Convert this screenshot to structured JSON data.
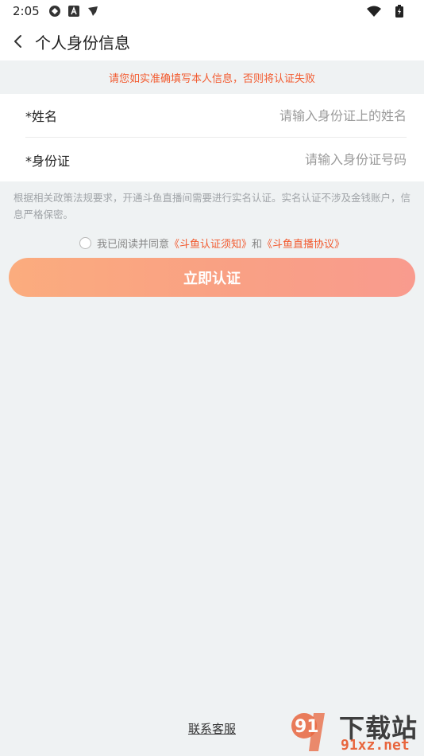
{
  "status_bar": {
    "time": "2:05"
  },
  "header": {
    "title": "个人身份信息"
  },
  "warning": "请您如实准确填写本人信息，否则将认证失败",
  "form": {
    "name_label": "*姓名",
    "name_placeholder": "请输入身份证上的姓名",
    "id_label": "*身份证",
    "id_placeholder": "请输入身份证号码"
  },
  "notice": "根据相关政策法规要求，开通斗鱼直播间需要进行实名认证。实名认证不涉及金钱账户，信息严格保密。",
  "agreement": {
    "prefix": "我已阅读并同意",
    "link1": "《斗鱼认证须知》",
    "middle": "和",
    "link2": "《斗鱼直播协议》"
  },
  "submit_label": "立即认证",
  "contact_label": "联系客服",
  "watermark": {
    "brand": "下载站",
    "url": "91xz.net",
    "logo_digits": "91"
  },
  "colors": {
    "accent": "#f25a2f",
    "button_start": "#fbac7e",
    "button_end": "#f99b8e",
    "background": "#eff2f3"
  }
}
